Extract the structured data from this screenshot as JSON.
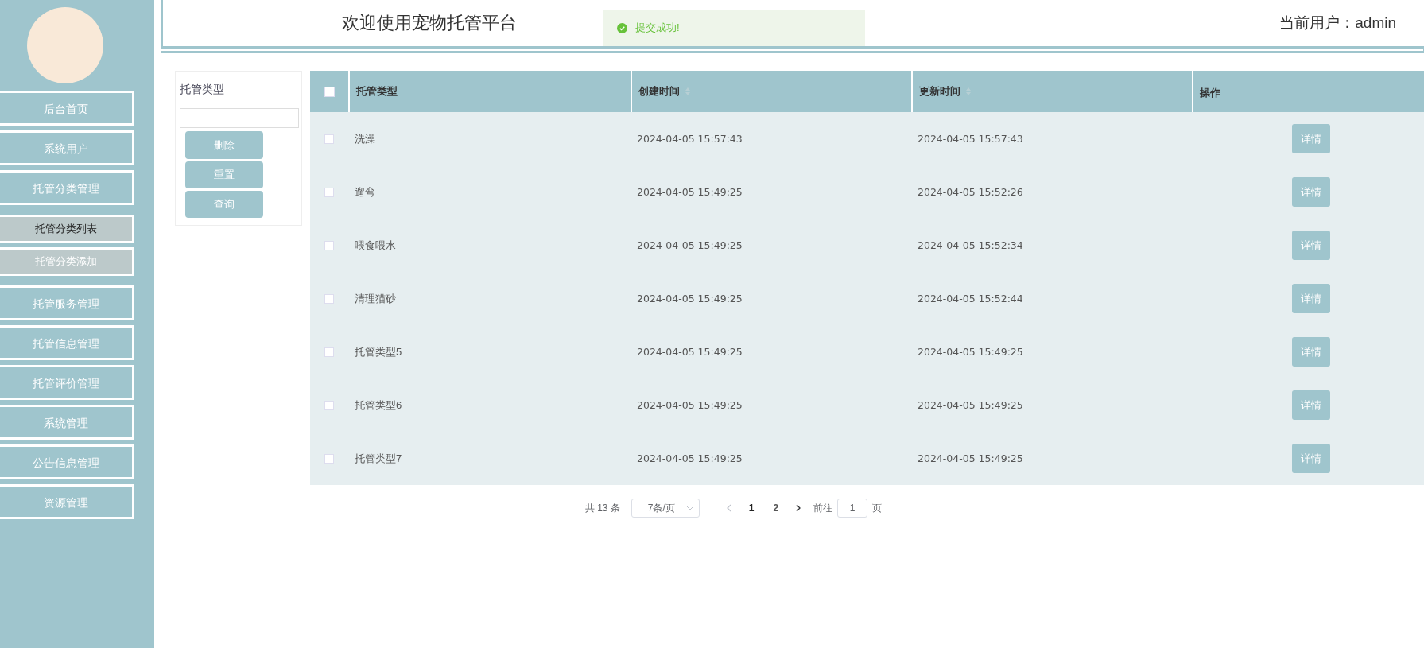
{
  "header": {
    "title": "欢迎使用宠物托管平台",
    "user": "当前用户：admin"
  },
  "toast": {
    "message": "提交成功!"
  },
  "sidebar": {
    "items": [
      {
        "label": "后台首页",
        "kind": "menu",
        "selected": false
      },
      {
        "label": "系统用户",
        "kind": "menu",
        "selected": false
      },
      {
        "label": "托管分类管理",
        "kind": "menu",
        "selected": false
      },
      {
        "label": "托管分类列表",
        "kind": "submenu",
        "selected": true
      },
      {
        "label": "托管分类添加",
        "kind": "submenu",
        "selected": false
      },
      {
        "label": "托管服务管理",
        "kind": "menu",
        "selected": false
      },
      {
        "label": "托管信息管理",
        "kind": "menu",
        "selected": false
      },
      {
        "label": "托管评价管理",
        "kind": "menu",
        "selected": false
      },
      {
        "label": "系统管理",
        "kind": "menu",
        "selected": false
      },
      {
        "label": "公告信息管理",
        "kind": "menu",
        "selected": false
      },
      {
        "label": "资源管理",
        "kind": "menu",
        "selected": false
      }
    ]
  },
  "search": {
    "label": "托管类型",
    "buttons": [
      "删除",
      "重置",
      "查询"
    ]
  },
  "table": {
    "select_all_checked": false,
    "columns": [
      {
        "label": "托管类型",
        "sortable": false
      },
      {
        "label": "创建时间",
        "sortable": true
      },
      {
        "label": "更新时间",
        "sortable": true
      },
      {
        "label": "操作",
        "sortable": false
      }
    ],
    "rows": [
      {
        "checked": false,
        "type": "洗澡",
        "created": "2024-04-05 15:57:43",
        "updated": "2024-04-05 15:57:43",
        "action": "详情"
      },
      {
        "checked": false,
        "type": "遛弯",
        "created": "2024-04-05 15:49:25",
        "updated": "2024-04-05 15:52:26",
        "action": "详情"
      },
      {
        "checked": false,
        "type": "喂食喂水",
        "created": "2024-04-05 15:49:25",
        "updated": "2024-04-05 15:52:34",
        "action": "详情"
      },
      {
        "checked": false,
        "type": "清理猫砂",
        "created": "2024-04-05 15:49:25",
        "updated": "2024-04-05 15:52:44",
        "action": "详情"
      },
      {
        "checked": false,
        "type": "托管类型5",
        "created": "2024-04-05 15:49:25",
        "updated": "2024-04-05 15:49:25",
        "action": "详情"
      },
      {
        "checked": false,
        "type": "托管类型6",
        "created": "2024-04-05 15:49:25",
        "updated": "2024-04-05 15:49:25",
        "action": "详情"
      },
      {
        "checked": false,
        "type": "托管类型7",
        "created": "2024-04-05 15:49:25",
        "updated": "2024-04-05 15:49:25",
        "action": "详情"
      }
    ]
  },
  "pagination": {
    "total": "共 13 条",
    "page_size": "7条/页",
    "pages": [
      {
        "label": "1",
        "selected": true
      },
      {
        "label": "2",
        "selected": false
      }
    ],
    "goto_label": "前往",
    "goto_value": "1",
    "goto_suffix": "页"
  }
}
